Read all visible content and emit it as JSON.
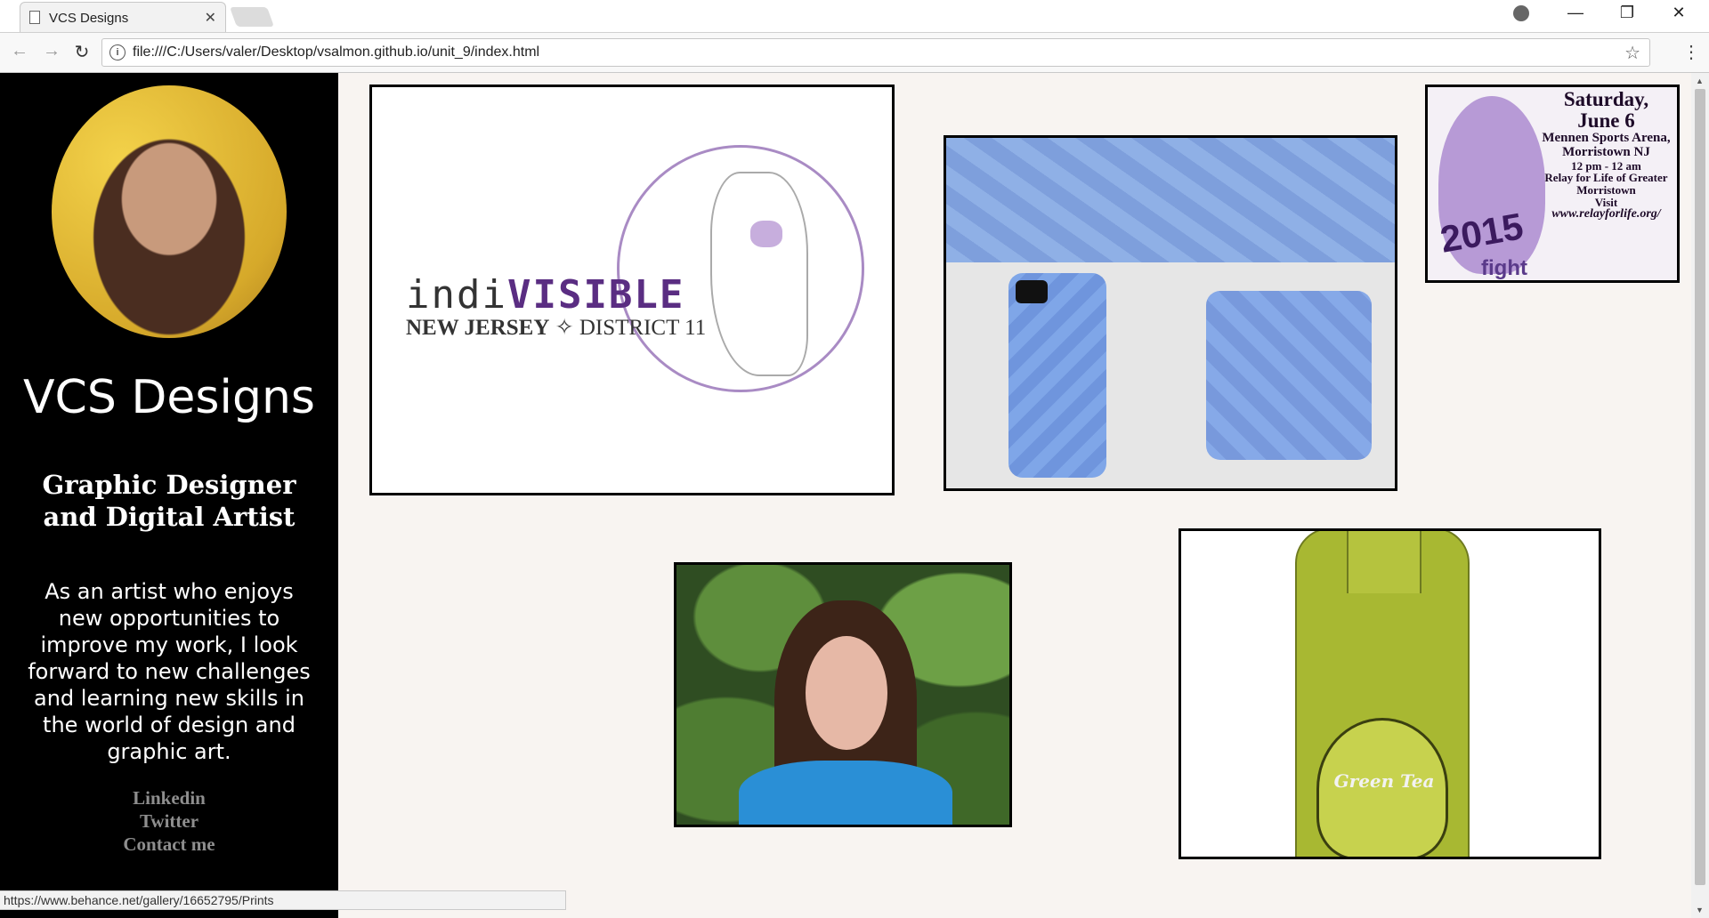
{
  "browser": {
    "tab_title": "VCS Designs",
    "url": "file:///C:/Users/valer/Desktop/vsalmon.github.io/unit_9/index.html",
    "status_url": "https://www.behance.net/gallery/16652795/Prints"
  },
  "sidebar": {
    "site_title": "VCS Designs",
    "tagline": "Graphic Designer and Digital Artist",
    "bio": "As an artist who enjoys new opportunities to improve my work, I look forward to new challenges and learning new skills in the world of design and graphic art.",
    "links": [
      "Linkedin",
      "Twitter",
      "Contact me"
    ]
  },
  "gallery": {
    "indivisible": {
      "word_a": "indi",
      "word_b": "VISIBLE",
      "line_2a": "NEW JERSEY",
      "line_2b": " ✧ DISTRICT 11"
    },
    "relay": {
      "line1": "Saturday,",
      "line2": "June 6",
      "line3": "Mennen Sports Arena,",
      "line4": "Morristown NJ",
      "line5": "12 pm - 12 am",
      "line6": "Relay for Life of Greater Morristown",
      "line7": "Visit",
      "line8": "www.relayforlife.org/",
      "year": "2015",
      "fight": "fight"
    },
    "bottle": {
      "label": "Green Tea"
    }
  },
  "colors": {
    "sidebar_bg": "#000000",
    "page_bg": "#f8f4f1",
    "link_color": "#8e8e8e",
    "accent_purple": "#5a2d82"
  }
}
